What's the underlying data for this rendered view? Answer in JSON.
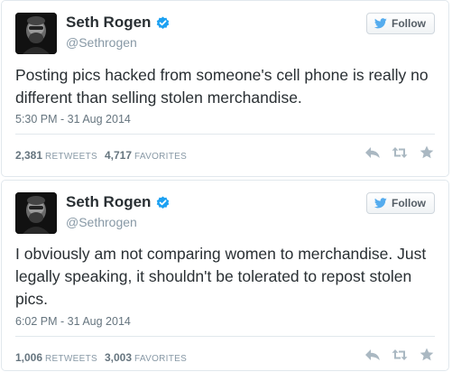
{
  "colors": {
    "verified": "#1da1f2",
    "twitter_blue": "#55acee",
    "text": "#292f33",
    "muted": "#8899a6",
    "icon_gray": "#aab8c2"
  },
  "tweets": [
    {
      "display_name": "Seth Rogen",
      "screen_name": "@Sethrogen",
      "follow_label": "Follow",
      "text": "Posting pics hacked from someone's cell phone is really no different than selling stolen merchandise.",
      "timestamp": "5:30 PM - 31 Aug 2014",
      "retweets_count": "2,381",
      "retweets_label": "RETWEETS",
      "favorites_count": "4,717",
      "favorites_label": "FAVORITES",
      "icons": [
        "verified-icon",
        "twitter-bird-icon",
        "reply-icon",
        "retweet-icon",
        "favorite-star-icon"
      ]
    },
    {
      "display_name": "Seth Rogen",
      "screen_name": "@Sethrogen",
      "follow_label": "Follow",
      "text": "I obviously am not comparing women to merchandise. Just legally speaking, it shouldn't be tolerated to repost stolen pics.",
      "timestamp": "6:02 PM - 31 Aug 2014",
      "retweets_count": "1,006",
      "retweets_label": "RETWEETS",
      "favorites_count": "3,003",
      "favorites_label": "FAVORITES",
      "icons": [
        "verified-icon",
        "twitter-bird-icon",
        "reply-icon",
        "retweet-icon",
        "favorite-star-icon"
      ]
    }
  ]
}
